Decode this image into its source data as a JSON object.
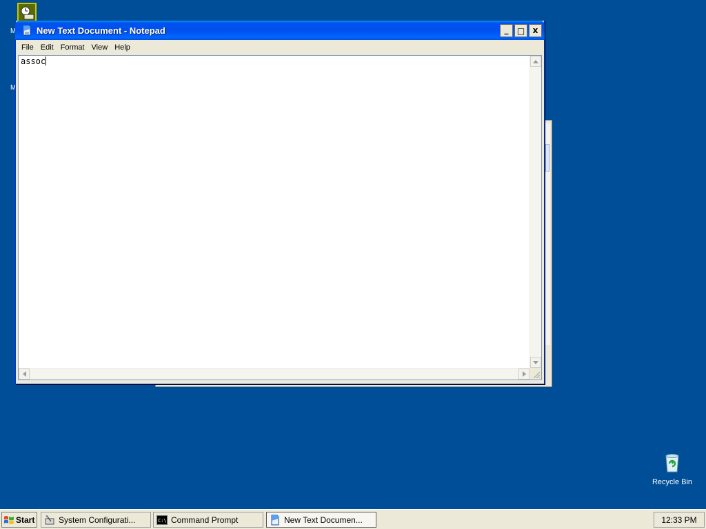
{
  "window": {
    "title": "New Text Document - Notepad",
    "controls": {
      "minimize": "_",
      "maximize": "□",
      "close": "x"
    },
    "menu": [
      "File",
      "Edit",
      "Format",
      "View",
      "Help"
    ],
    "content": "assoc"
  },
  "desktop": {
    "recycle_bin_label": "Recycle Bin",
    "partial_labels": [
      "M",
      "M"
    ]
  },
  "taskbar": {
    "start_label": "Start",
    "tasks": [
      {
        "label": "System Configurati...",
        "icon": "system-config-icon",
        "active": false
      },
      {
        "label": "Command Prompt",
        "icon": "command-prompt-icon",
        "active": false
      },
      {
        "label": "New Text Documen...",
        "icon": "notepad-icon",
        "active": true
      }
    ],
    "clock": "12:33 PM"
  },
  "colors": {
    "desktop_bg": "#004e98",
    "titlebar": "#0050ee",
    "chrome": "#ece9d8"
  }
}
